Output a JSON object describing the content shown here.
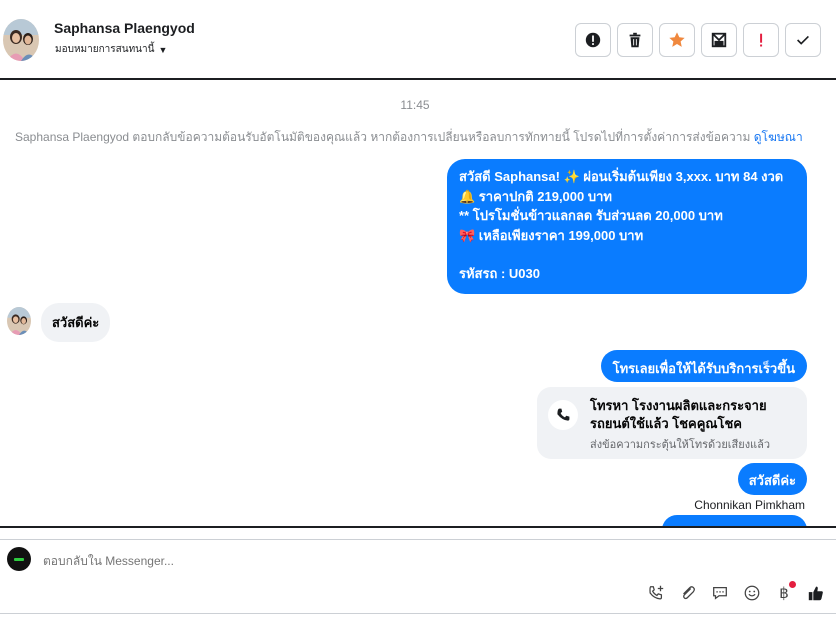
{
  "header": {
    "name": "Saphansa Plaengyod",
    "assign_label": "มอบหมายการสนทนานี้",
    "tools": [
      "info-icon",
      "trash-icon",
      "star-icon",
      "spam-icon",
      "important-icon",
      "check-icon"
    ],
    "colors": {
      "star": "#f0883e",
      "important": "#e41e3f"
    }
  },
  "conversation": {
    "time": "11:45",
    "notice_text": "Saphansa Plaengyod ตอบกลับข้อความต้อนรับอัตโนมัติของคุณแล้ว หากต้องการเปลี่ยนหรือลบการทักทายนี้ โปรดไปที่การตั้งค่าการส่งข้อความ",
    "notice_link": "ดูโฆษณา",
    "message1_lines": [
      "สวัสดี Saphansa! ✨  ผ่อนเริ่มต้นเพียง 3,xxx. บาท 84 งวด",
      "🔔 ราคาปกติ  219,000 บาท",
      "** โปรโมชั่นข้าวแลกลด รับส่วนลด 20,000 บาท",
      "🎀  เหลือเพียงราคา 199,000 บาท",
      "",
      "รหัสรถ : U030"
    ],
    "incoming_text": "สวัสดีค่ะ",
    "message2": "โทรเลยเพื่อให้ได้รับบริการเร็วขึ้น",
    "call_card": {
      "title": "โทรหา โรงงานผลิตและกระจาย รถยนต์ใช้แล้ว โชคคูณโชค",
      "subtitle": "ส่งข้อความกระตุ้นให้โทรด้วยเสียงแล้ว"
    },
    "message3": "สวัสดีค่ะ",
    "sender_name": "Chonnikan Pimkham",
    "bubble_color": "#0a7cff"
  },
  "composer": {
    "placeholder": "ตอบกลับใน Messenger...",
    "actions": [
      "phone-plus-icon",
      "paperclip-icon",
      "chat-bubble-icon",
      "smiley-icon",
      "baht-icon",
      "thumbs-up-icon"
    ],
    "baht_symbol": "฿"
  }
}
